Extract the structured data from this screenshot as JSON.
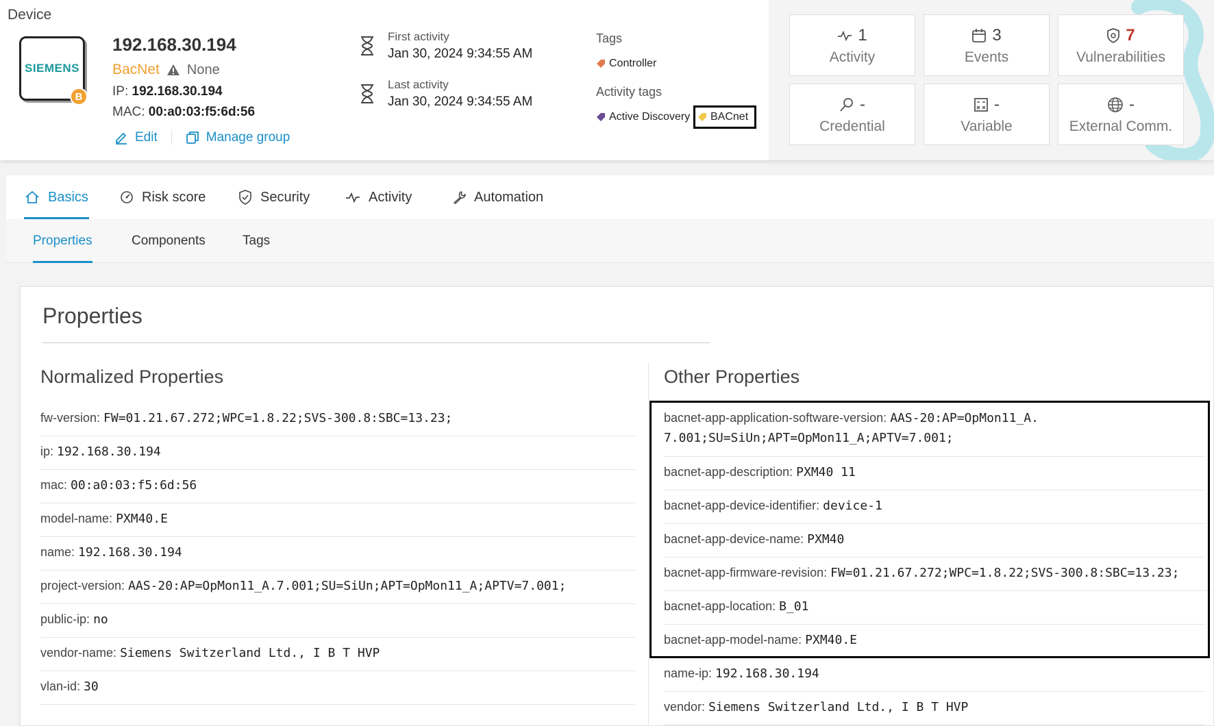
{
  "breadcrumb": "Device",
  "device": {
    "logo_text": "SIEMENS",
    "logo_badge": "B",
    "ip_title": "192.168.30.194",
    "protocol": "BacNet",
    "protocol_status": "None",
    "ip_label": "IP:",
    "ip_value": "192.168.30.194",
    "mac_label": "MAC:",
    "mac_value": "00:a0:03:f5:6d:56",
    "edit_label": "Edit",
    "manage_group_label": "Manage group"
  },
  "activity": {
    "first_label": "First activity",
    "first_value": "Jan 30, 2024 9:34:55 AM",
    "last_label": "Last activity",
    "last_value": "Jan 30, 2024 9:34:55 AM"
  },
  "tags": {
    "tags_label": "Tags",
    "tag_items": [
      "Controller"
    ],
    "activity_tags_label": "Activity tags",
    "activity_tag_items": [
      "Active Discovery",
      "BACnet"
    ],
    "colors": {
      "controller": "#e07b50",
      "active_discovery": "#6a4c93",
      "bacnet": "#f2c94c"
    }
  },
  "tiles": [
    {
      "icon": "activity-icon",
      "count": "1",
      "label": "Activity"
    },
    {
      "icon": "calendar-icon",
      "count": "3",
      "label": "Events"
    },
    {
      "icon": "shield-icon",
      "count": "7",
      "label": "Vulnerabilities",
      "color": "#c0392b"
    },
    {
      "icon": "key-icon",
      "count": "-",
      "label": "Credential"
    },
    {
      "icon": "variable-icon",
      "count": "-",
      "label": "Variable"
    },
    {
      "icon": "globe-icon",
      "count": "-",
      "label": "External Comm."
    }
  ],
  "tabs": [
    {
      "label": "Basics",
      "icon": "home-icon",
      "active": true
    },
    {
      "label": "Risk score",
      "icon": "gauge-icon"
    },
    {
      "label": "Security",
      "icon": "shield-check-icon"
    },
    {
      "label": "Activity",
      "icon": "activity-icon"
    },
    {
      "label": "Automation",
      "icon": "wrench-icon"
    }
  ],
  "subtabs": [
    {
      "label": "Properties",
      "active": true
    },
    {
      "label": "Components"
    },
    {
      "label": "Tags"
    }
  ],
  "properties": {
    "title": "Properties",
    "normalized_title": "Normalized Properties",
    "normalized": [
      {
        "key": "fw-version:",
        "value": "FW=01.21.67.272;WPC=1.8.22;SVS-300.8:SBC=13.23;"
      },
      {
        "key": "ip:",
        "value": "192.168.30.194"
      },
      {
        "key": "mac:",
        "value": "00:a0:03:f5:6d:56"
      },
      {
        "key": "model-name:",
        "value": "PXM40.E"
      },
      {
        "key": "name:",
        "value": "192.168.30.194"
      },
      {
        "key": "project-version:",
        "value": "AAS-20:AP=OpMon11_A.7.001;SU=SiUn;APT=OpMon11_A;APTV=7.001;"
      },
      {
        "key": "public-ip:",
        "value": "no"
      },
      {
        "key": "vendor-name:",
        "value": "Siemens Switzerland Ltd., I B T HVP"
      },
      {
        "key": "vlan-id:",
        "value": "30"
      }
    ],
    "other_title": "Other Properties",
    "other": [
      {
        "key": "bacnet-app-application-software-version:",
        "value": "AAS-20:AP=OpMon11_A.",
        "value2": "7.001;SU=SiUn;APT=OpMon11_A;APTV=7.001;"
      },
      {
        "key": "bacnet-app-description:",
        "value": "PXM40 11"
      },
      {
        "key": "bacnet-app-device-identifier:",
        "value": "device-1"
      },
      {
        "key": "bacnet-app-device-name:",
        "value": "PXM40"
      },
      {
        "key": "bacnet-app-firmware-revision:",
        "value": "FW=01.21.67.272;WPC=1.8.22;SVS-300.8:SBC=13.23;"
      },
      {
        "key": "bacnet-app-location:",
        "value": "B_01"
      },
      {
        "key": "bacnet-app-model-name:",
        "value": "PXM40.E"
      },
      {
        "key": "name-ip:",
        "value": "192.168.30.194"
      },
      {
        "key": "vendor:",
        "value": "Siemens Switzerland Ltd., I B T HVP"
      }
    ]
  }
}
